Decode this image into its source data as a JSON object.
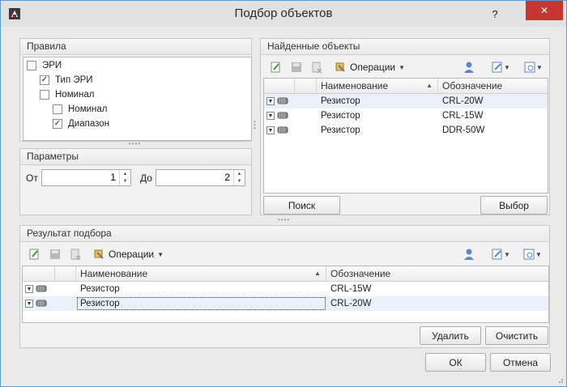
{
  "window": {
    "title": "Подбор объектов",
    "help_glyph": "?",
    "close_glyph": "✕"
  },
  "rules_panel": {
    "title": "Правила",
    "items": [
      {
        "label": "ЭРИ",
        "checked": false,
        "indent": 0
      },
      {
        "label": "Тип ЭРИ",
        "checked": true,
        "indent": 1
      },
      {
        "label": "Номинал",
        "checked": false,
        "indent": 1
      },
      {
        "label": "Номинал",
        "checked": false,
        "indent": 2
      },
      {
        "label": "Диапазон",
        "checked": true,
        "indent": 2
      }
    ]
  },
  "params_panel": {
    "title": "Параметры",
    "from_label": "От",
    "from_value": "1",
    "to_label": "До",
    "to_value": "2"
  },
  "found_panel": {
    "title": "Найденные объекты",
    "operations_label": "Операции",
    "columns": [
      "Наименование",
      "Обозначение"
    ],
    "rows": [
      {
        "name": "Резистор",
        "designation": "CRL-20W"
      },
      {
        "name": "Резистор",
        "designation": "CRL-15W"
      },
      {
        "name": "Резистор",
        "designation": "DDR-50W"
      }
    ],
    "search_button": "Поиск",
    "select_button": "Выбор"
  },
  "result_panel": {
    "title": "Результат подбора",
    "operations_label": "Операции",
    "columns": [
      "Наименование",
      "Обозначение"
    ],
    "rows": [
      {
        "name": "Резистор",
        "designation": "CRL-15W"
      },
      {
        "name": "Резистор",
        "designation": "CRL-20W"
      }
    ],
    "delete_button": "Удалить",
    "clear_button": "Очистить"
  },
  "footer": {
    "ok_button": "ОК",
    "cancel_button": "Отмена"
  },
  "icons": {
    "add": "add-document-icon",
    "save": "save-icon",
    "delete": "delete-document-icon",
    "operations": "operations-icon",
    "user": "user-search-icon",
    "edit": "edit-dropdown-icon",
    "view": "view-dropdown-icon",
    "resistor": "resistor-icon"
  },
  "colors": {
    "accent_border": "#5b9bd5",
    "close_button": "#c7372f",
    "row_highlight": "#eaf1fb"
  }
}
